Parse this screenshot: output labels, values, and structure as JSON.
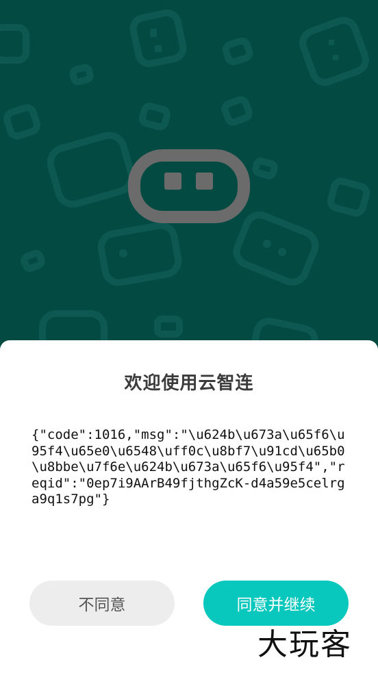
{
  "background": {
    "color": "#034a43",
    "logo_color": "#6b6b6b",
    "pattern_color": "#0f5a52"
  },
  "dialog": {
    "title": "欢迎使用云智连",
    "message": "{\"code\":1016,\"msg\":\"\\u624b\\u673a\\u65f6\\u95f4\\u65e0\\u6548\\uff0c\\u8bf7\\u91cd\\u65b0\\u8bbe\\u7f6e\\u624b\\u673a\\u65f6\\u95f4\",\"reqid\":\"0ep7i9AArB49fjthgZcK-d4a59e5celrga9q1s7pg\"}",
    "buttons": {
      "disagree_label": "不同意",
      "agree_label": "同意并继续"
    },
    "accent_color": "#08c8bd"
  },
  "watermark": {
    "text": "大玩客"
  }
}
